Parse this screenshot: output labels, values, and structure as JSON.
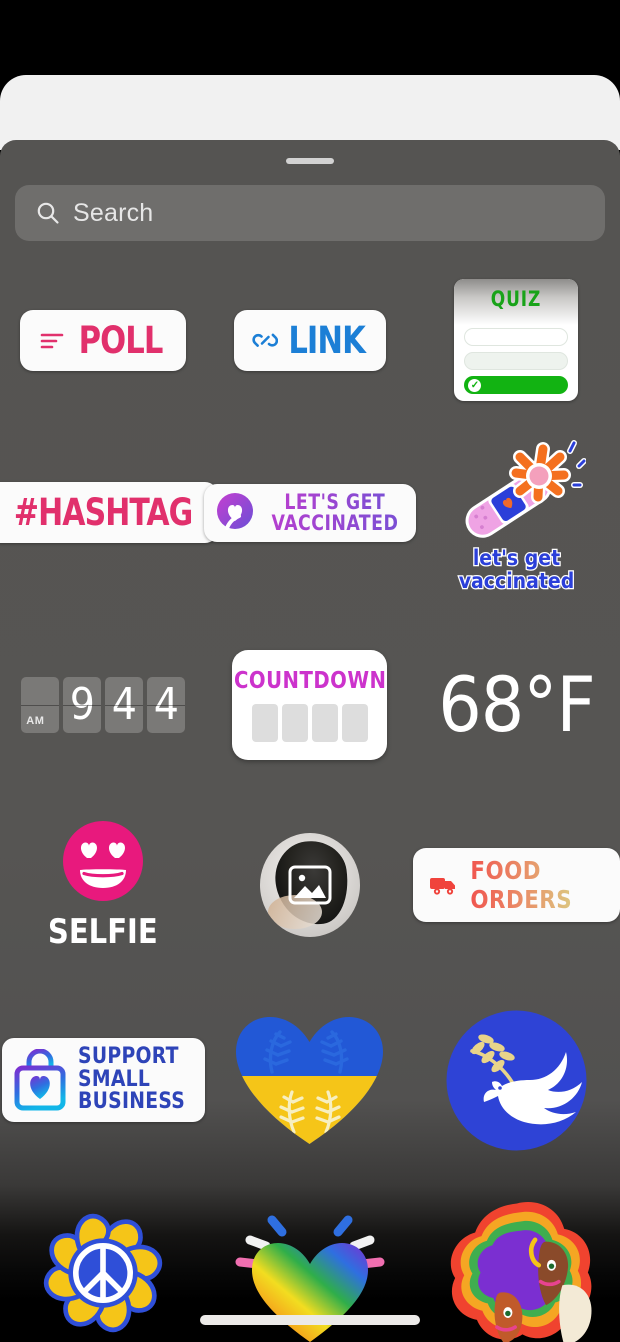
{
  "app": {
    "surface": "instagram-story-sticker-tray",
    "background_color": "#000000",
    "tray_color": "#555452",
    "sheet_color": "#f1f1f1"
  },
  "search": {
    "placeholder": "Search",
    "icon": "search-icon"
  },
  "handle": {
    "name": "drag-handle"
  },
  "colors": {
    "poll_pink": "#e1306c",
    "link_blue": "#1c7fd6",
    "quiz_green": "#19a319",
    "countdown_magenta": "#cc33cc",
    "vaccinated_purple": "#b43fcf",
    "vaccinated_blue": "#2b3fd9",
    "business_blue": "#2e44b8",
    "food_red": "#f0554f",
    "ukraine_blue": "#2258d6",
    "ukraine_yellow": "#f5c518",
    "white": "#ffffff"
  },
  "stickers": {
    "rows": [
      {
        "row": 1,
        "items": [
          {
            "name": "poll-sticker",
            "label": "POLL",
            "icon": "poll-bars-icon",
            "type": "pill"
          },
          {
            "name": "link-sticker",
            "label": "LINK",
            "icon": "link-chain-icon",
            "type": "pill"
          },
          {
            "name": "quiz-sticker",
            "label": "QUIZ",
            "type": "card",
            "options": [
              "",
              "",
              ""
            ],
            "correct_option_index": 2,
            "check_glyph": "✓"
          }
        ]
      },
      {
        "row": 2,
        "items": [
          {
            "name": "hashtag-sticker",
            "label": "#HASHTAG",
            "type": "pill"
          },
          {
            "name": "lets-get-vaccinated-badge",
            "type": "pill",
            "icon": "heart-ribbon-icon",
            "line1": "LET'S GET",
            "line2": "VACCINATED"
          },
          {
            "name": "vaccinated-flower-bandaid-sticker",
            "type": "art",
            "line1": "let's get",
            "line2": "vaccinated"
          }
        ]
      },
      {
        "row": 3,
        "items": [
          {
            "name": "clock-sticker",
            "type": "flip-clock",
            "meridiem": "AM",
            "digits": [
              "9",
              "4",
              "4"
            ]
          },
          {
            "name": "countdown-sticker",
            "type": "card",
            "label": "COUNTDOWN",
            "slots": 4
          },
          {
            "name": "temperature-sticker",
            "type": "text",
            "label": "68°F"
          }
        ]
      },
      {
        "row": 4,
        "items": [
          {
            "name": "selfie-sticker",
            "type": "art",
            "label": "SELFIE",
            "icon": "heart-eyes-face-icon"
          },
          {
            "name": "photo-sticker",
            "type": "art",
            "icon": "photo-frame-icon"
          },
          {
            "name": "food-orders-sticker",
            "type": "pill",
            "label": "FOOD ORDERS",
            "icon": "delivery-truck-icon"
          }
        ]
      },
      {
        "row": 5,
        "items": [
          {
            "name": "support-small-business-sticker",
            "type": "pill",
            "icon": "shopping-bag-heart-icon",
            "line1": "SUPPORT",
            "line2": "SMALL",
            "line3": "BUSINESS"
          },
          {
            "name": "ukraine-heart-sticker",
            "type": "art"
          },
          {
            "name": "peace-dove-sticker",
            "type": "art"
          }
        ]
      },
      {
        "row": 6,
        "items": [
          {
            "name": "peace-flower-sticker",
            "type": "art"
          },
          {
            "name": "rainbow-heart-sticker",
            "type": "art"
          },
          {
            "name": "pride-faces-sticker",
            "type": "art"
          }
        ]
      }
    ]
  },
  "home_indicator": {
    "name": "home-indicator"
  }
}
